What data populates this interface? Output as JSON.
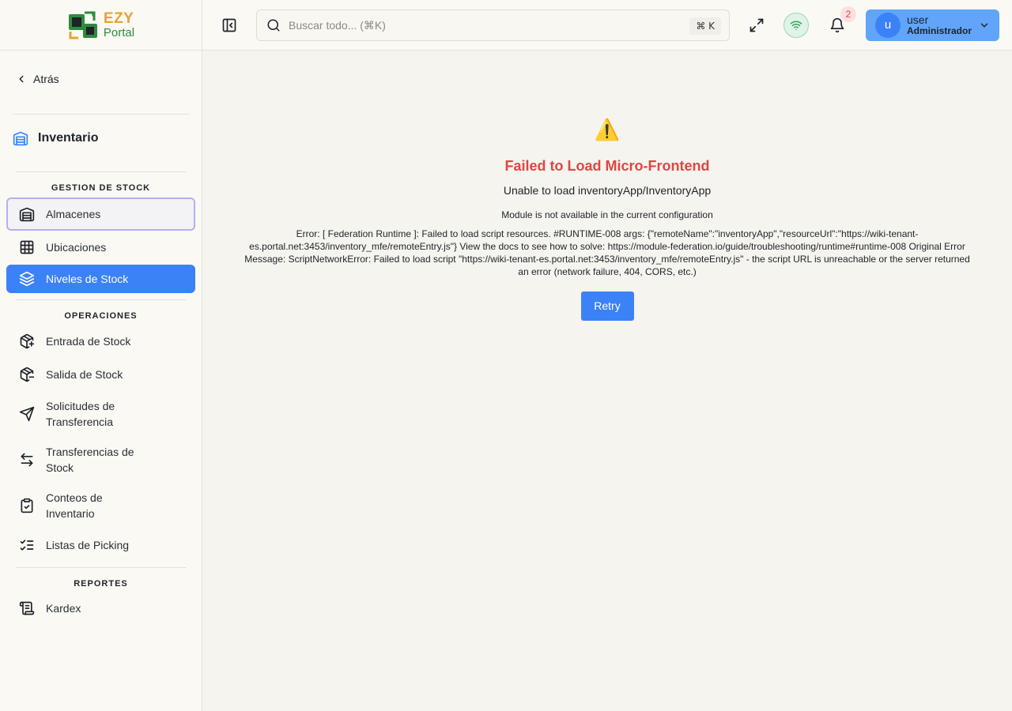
{
  "brand": {
    "name_top": "EZY",
    "name_bottom": "Portal"
  },
  "sidebar": {
    "back_label": "Atrás",
    "module_title": "Inventario",
    "sections": [
      {
        "title": "GESTION DE STOCK"
      },
      {
        "title": "OPERACIONES"
      },
      {
        "title": "REPORTES"
      }
    ],
    "items": [
      {
        "label": "Almacenes",
        "icon": "warehouse-icon"
      },
      {
        "label": "Ubicaciones",
        "icon": "grid-icon"
      },
      {
        "label": "Niveles de Stock",
        "icon": "layers-icon",
        "active": true
      },
      {
        "label": "Entrada de Stock",
        "icon": "package-plus-icon"
      },
      {
        "label": "Salida de Stock",
        "icon": "package-minus-icon"
      },
      {
        "label": "Solicitudes de Transferencia",
        "icon": "send-icon"
      },
      {
        "label": "Transferencias de Stock",
        "icon": "arrows-left-right-icon"
      },
      {
        "label": "Conteos de Inventario",
        "icon": "clipboard-check-icon"
      },
      {
        "label": "Listas de Picking",
        "icon": "list-checks-icon"
      },
      {
        "label": "Kardex",
        "icon": "scroll-icon"
      }
    ]
  },
  "topbar": {
    "search_placeholder": "Buscar todo... (⌘K)",
    "search_shortcut": "⌘ K",
    "notifications_count": "2",
    "user_initial": "u",
    "user_name": "user",
    "user_role": "Administrador"
  },
  "error": {
    "icon": "⚠️",
    "title": "Failed to Load Micro-Frontend",
    "subtitle": "Unable to load inventoryApp/InventoryApp",
    "message": "Module is not available in the current configuration",
    "detail": "Error: [ Federation Runtime ]: Failed to load script resources. #RUNTIME-008 args: {\"remoteName\":\"inventoryApp\",\"resourceUrl\":\"https://wiki-tenant-es.portal.net:3453/inventory_mfe/remoteEntry.js\"} View the docs to see how to solve: https://module-federation.io/guide/troubleshooting/runtime#runtime-008 Original Error Message: ScriptNetworkError: Failed to load script \"https://wiki-tenant-es.portal.net:3453/inventory_mfe/remoteEntry.js\" - the script URL is unreachable or the server returned an error (network failure, 404, CORS, etc.)",
    "retry_label": "Retry"
  },
  "colors": {
    "accent": "#3b82f6",
    "error": "#e04545",
    "brand_orange": "#e8a23a",
    "brand_green": "#2e8b3d"
  }
}
